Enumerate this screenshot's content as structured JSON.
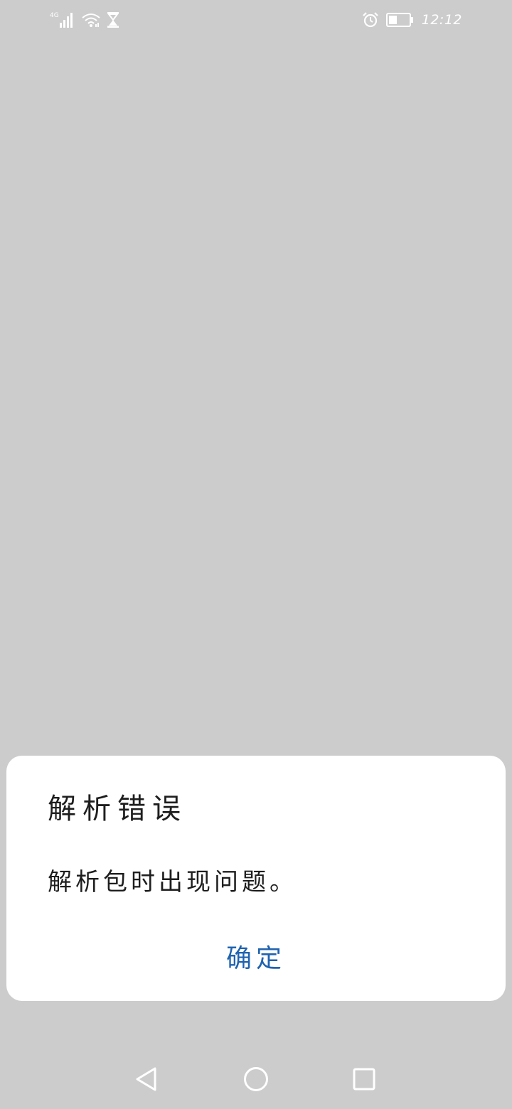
{
  "status_bar": {
    "network_label": "4G",
    "time": "12:12",
    "icons": {
      "signal": "cellular-signal-icon",
      "wifi": "wifi-icon",
      "hourglass": "hourglass-icon",
      "alarm": "alarm-icon",
      "battery": "battery-icon"
    },
    "icon_color": "#ffffff"
  },
  "dialog": {
    "title": "解析错误",
    "message": "解析包时出现问题。",
    "confirm_label": "确定",
    "accent_color": "#1f63b0"
  },
  "nav_bar": {
    "icons": {
      "back": "back-triangle-icon",
      "home": "home-circle-icon",
      "recents": "recents-square-icon"
    }
  },
  "colors": {
    "background": "#cccccc",
    "dialog_background": "#ffffff",
    "text": "#1e1e1e"
  }
}
